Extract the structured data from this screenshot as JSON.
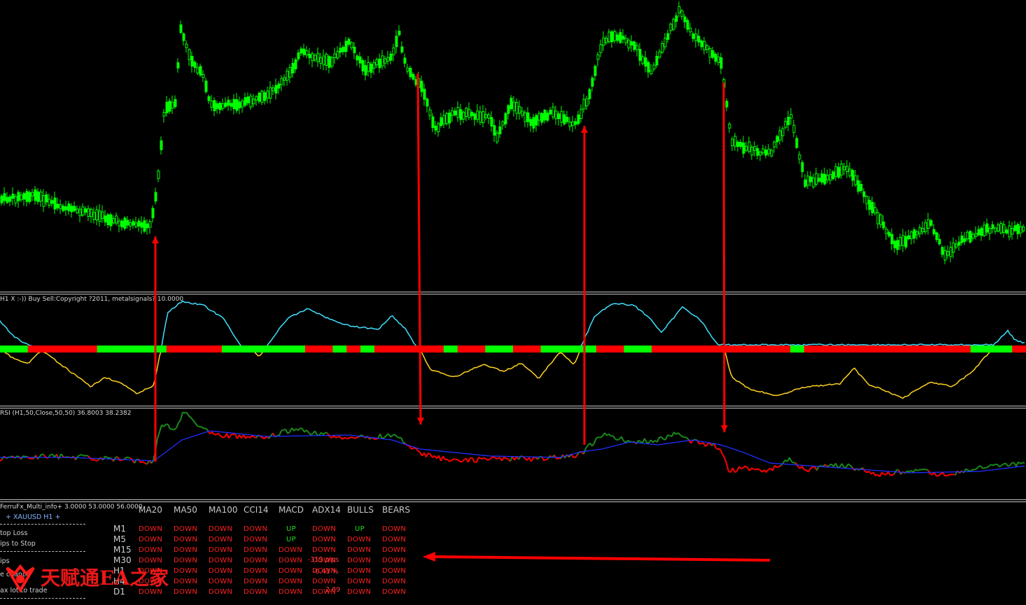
{
  "chart_data": [
    {
      "type": "candlestick",
      "symbol": "XAUUSD",
      "timeframe": "H1",
      "title": "",
      "colors": {
        "candle": "#00ff00",
        "background": "#000000"
      }
    },
    {
      "type": "line",
      "label": "H1 X :-))  Buy Sell:Copyright ?2011, metalsignals?  10.0000",
      "colors": {
        "upper_line": "#3fe0ff",
        "lower_line": "#ffd21f",
        "bar_up": "#00ff00",
        "bar_down": "#ff0000"
      },
      "signal_bar": [
        "up",
        "up",
        "down",
        "down",
        "down",
        "down",
        "down",
        "up",
        "up",
        "up",
        "up",
        "up",
        "down",
        "down",
        "down",
        "down",
        "up",
        "up",
        "up",
        "up",
        "up",
        "up",
        "down",
        "down",
        "up",
        "down",
        "up",
        "down",
        "down",
        "down",
        "down",
        "down",
        "up",
        "down",
        "down",
        "up",
        "up",
        "down",
        "down",
        "up",
        "up",
        "up",
        "up",
        "down",
        "down",
        "up",
        "up",
        "down",
        "down",
        "down",
        "down",
        "down",
        "down",
        "down",
        "down",
        "down",
        "down",
        "up",
        "down",
        "down",
        "down",
        "down",
        "down",
        "down",
        "down",
        "down",
        "down",
        "down",
        "down",
        "down",
        "up",
        "up",
        "up",
        "down"
      ]
    },
    {
      "type": "line",
      "label": "RSI (H1,50,Close,50,50) 36.8003 38.2382",
      "series": [
        {
          "name": "RSI",
          "last": 36.8003
        },
        {
          "name": "Signal",
          "last": 38.2382
        }
      ],
      "colors": {
        "rsi_up": "#1a8a1a",
        "rsi_down": "#ff0000",
        "signal": "#1f2fff"
      }
    }
  ],
  "annotations": {
    "arrow_color": "#ff0000",
    "arrows": [
      {
        "direction": "up",
        "type": "vertical"
      },
      {
        "direction": "down",
        "type": "vertical"
      },
      {
        "direction": "up",
        "type": "vertical"
      },
      {
        "direction": "down",
        "type": "vertical"
      },
      {
        "direction": "left",
        "type": "horizontal"
      }
    ]
  },
  "panel_labels": {
    "osc": "H1 X :-))  Buy Sell:Copyright ?2011, metalsignals?  10.0000",
    "rsi": "RSI (H1,50,Close,50,50) 36.8003 38.2382",
    "multi": "FerruFx_Multi_info+ 3.0000 53.0000 56.0000"
  },
  "multi_info": {
    "symbol_line": "+ XAUUSD  H1  +",
    "side": [
      "top Loss",
      "ips to Stop",
      "ips",
      "e chance",
      "ax lot to trade"
    ],
    "overlay": [
      "-319 pips",
      "-0.43 %",
      "2.89"
    ],
    "headers": [
      "MA20",
      "MA50",
      "MA100",
      "CCI14",
      "MACD",
      "ADX14",
      "BULLS",
      "BEARS"
    ],
    "timeframes": [
      "M1",
      "M5",
      "M15",
      "M30",
      "H1",
      "H4",
      "D1"
    ],
    "cells": [
      [
        "DOWN",
        "DOWN",
        "DOWN",
        "DOWN",
        "UP",
        "DOWN",
        "UP",
        "DOWN"
      ],
      [
        "DOWN",
        "DOWN",
        "DOWN",
        "DOWN",
        "UP",
        "DOWN",
        "DOWN",
        "DOWN"
      ],
      [
        "DOWN",
        "DOWN",
        "DOWN",
        "DOWN",
        "DOWN",
        "DOWN",
        "DOWN",
        "DOWN"
      ],
      [
        "DOWN",
        "DOWN",
        "DOWN",
        "DOWN",
        "DOWN",
        "DOWN",
        "DOWN",
        "DOWN"
      ],
      [
        "DOWN",
        "DOWN",
        "DOWN",
        "DOWN",
        "DOWN",
        "DOWN",
        "DOWN",
        "DOWN"
      ],
      [
        "DOWN",
        "DOWN",
        "DOWN",
        "DOWN",
        "DOWN",
        "DOWN",
        "DOWN",
        "DOWN"
      ],
      [
        "DOWN",
        "DOWN",
        "DOWN",
        "DOWN",
        "DOWN",
        "DOWN",
        "DOWN",
        "DOWN"
      ]
    ],
    "colors": {
      "up": "#22dd22",
      "down": "#ff2020",
      "header": "#c8c8c8"
    }
  },
  "watermark": {
    "text": "天赋通EA之家"
  }
}
